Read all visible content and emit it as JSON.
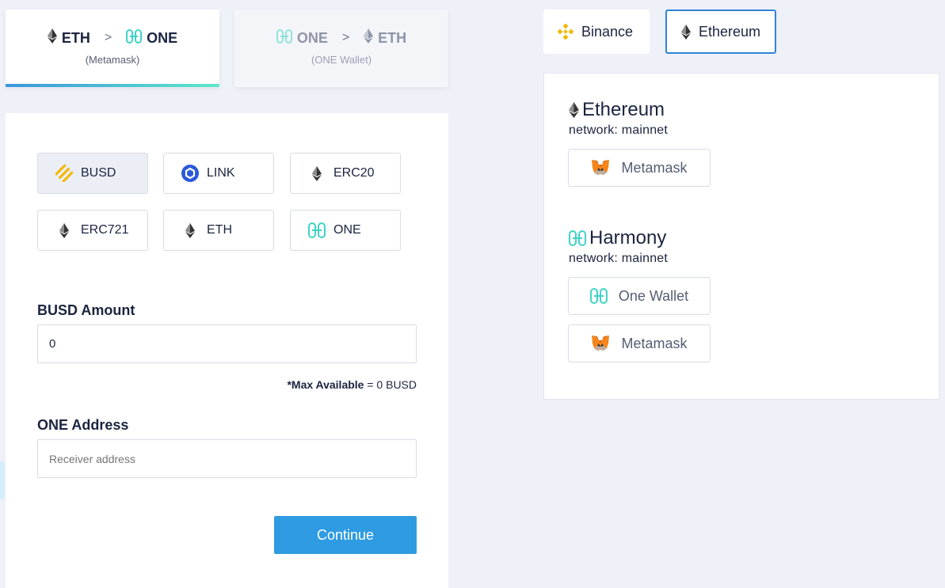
{
  "directions": [
    {
      "from": "ETH",
      "to": "ONE",
      "wallet": "(Metamask)",
      "active": true
    },
    {
      "from": "ONE",
      "to": "ETH",
      "wallet": "(ONE Wallet)",
      "active": false
    }
  ],
  "tokens": [
    {
      "label": "BUSD",
      "icon": "busd-icon",
      "selected": true
    },
    {
      "label": "LINK",
      "icon": "chainlink-icon",
      "selected": false
    },
    {
      "label": "ERC20",
      "icon": "ethereum-icon",
      "selected": false
    },
    {
      "label": "ERC721",
      "icon": "ethereum-icon",
      "selected": false
    },
    {
      "label": "ETH",
      "icon": "ethereum-icon",
      "selected": false
    },
    {
      "label": "ONE",
      "icon": "harmony-icon",
      "selected": false
    }
  ],
  "form": {
    "amount_label": "BUSD Amount",
    "amount_value": "0",
    "max_label": "*Max Available",
    "max_value": "= 0 BUSD",
    "address_label": "ONE Address",
    "address_placeholder": "Receiver address",
    "continue_label": "Continue"
  },
  "network_tabs": [
    {
      "label": "Binance",
      "icon": "binance-icon",
      "active": false
    },
    {
      "label": "Ethereum",
      "icon": "ethereum-icon",
      "active": true
    }
  ],
  "wallets": {
    "ethereum": {
      "title": "Ethereum",
      "network_key": "network:",
      "network_value": "mainnet",
      "buttons": [
        "Metamask"
      ]
    },
    "harmony": {
      "title": "Harmony",
      "network_key": "network:",
      "network_value": "mainnet",
      "buttons": [
        "One Wallet",
        "Metamask"
      ]
    }
  },
  "colors": {
    "accent_blue": "#2f9be2",
    "active_border": "#2f83d8",
    "harmony_teal": "#3fd4c6",
    "binance_yellow": "#f0b90b",
    "chainlink_blue": "#2a5ada"
  }
}
